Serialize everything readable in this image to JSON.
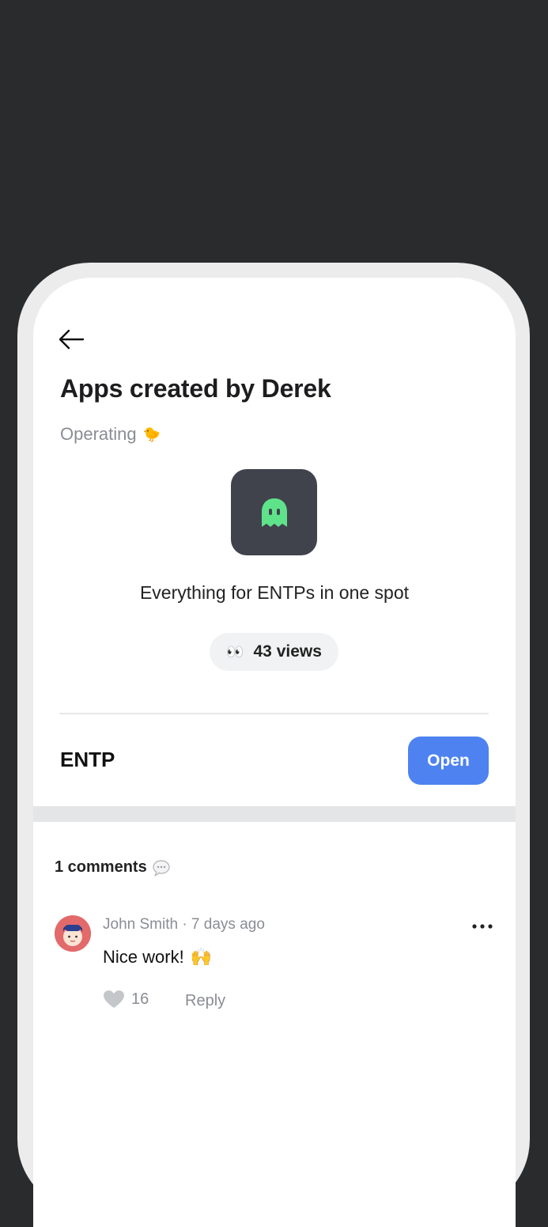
{
  "header": {
    "back_icon": "arrow-left-icon",
    "title": "Apps created by Derek",
    "subtitle": "Operating",
    "subtitle_emoji": "🐤"
  },
  "app": {
    "icon": "ghost-icon",
    "icon_bg": "#40424c",
    "icon_color": "#5fe38a",
    "tagline": "Everything for ENTPs in one spot",
    "views_emoji": "👀",
    "views_label": "43 views",
    "name": "ENTP",
    "open_label": "Open",
    "accent": "#4d82f0"
  },
  "comments": {
    "heading": "1 comments",
    "heading_icon": "speech-bubble-icon",
    "items": [
      {
        "meta": "John Smith · 7 days ago",
        "text": "Nice work!",
        "text_emoji": "🙌",
        "likes": "16",
        "reply_label": "Reply",
        "more_icon": "more-horizontal-icon"
      }
    ]
  }
}
